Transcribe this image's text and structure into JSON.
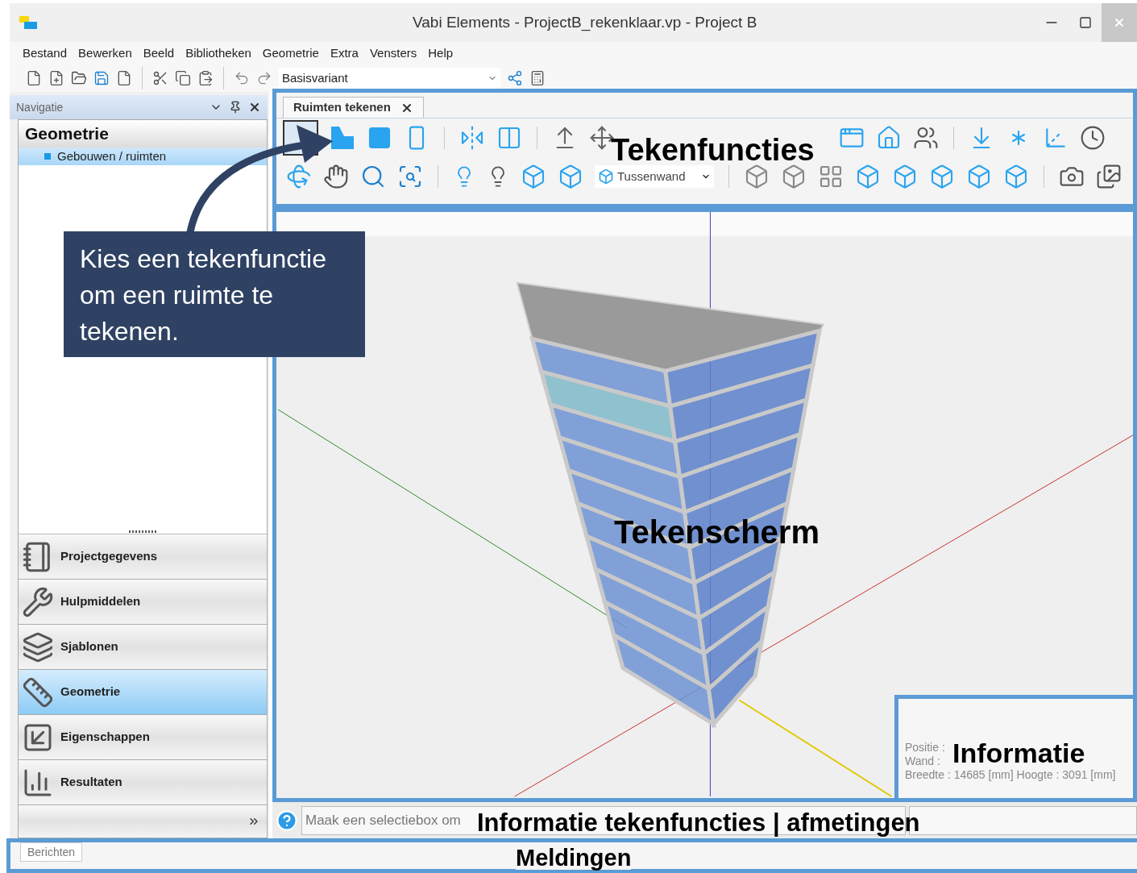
{
  "window": {
    "title": "Vabi Elements - ProjectB_rekenklaar.vp - Project B"
  },
  "menu": [
    "Bestand",
    "Bewerken",
    "Beeld",
    "Bibliotheken",
    "Geometrie",
    "Extra",
    "Vensters",
    "Help"
  ],
  "toolbar": {
    "variant": "Basisvariant"
  },
  "navigation": {
    "title": "Navigatie",
    "heading": "Geometrie",
    "tree": [
      {
        "label": "Gebouwen / ruimten",
        "selected": true
      }
    ],
    "modules": [
      {
        "kind": "project",
        "label": "Projectgegevens",
        "selected": false
      },
      {
        "kind": "tools",
        "label": "Hulpmiddelen",
        "selected": false
      },
      {
        "kind": "templates",
        "label": "Sjablonen",
        "selected": false
      },
      {
        "kind": "geometry",
        "label": "Geometrie",
        "selected": true
      },
      {
        "kind": "properties",
        "label": "Eigenschappen",
        "selected": false
      },
      {
        "kind": "results",
        "label": "Resultaten",
        "selected": false
      }
    ]
  },
  "document_tab": {
    "label": "Ruimten tekenen"
  },
  "drawing_toolbar": {
    "wall_type": "Tussenwand"
  },
  "info_panel": {
    "lines": [
      "Positie :",
      "Wand :",
      "Breedte : 14685 [mm] Hoogte : 3091 [mm]"
    ]
  },
  "status_bar": {
    "hint": "Maak een selectiebox om"
  },
  "messages_tab": {
    "label": "Berichten"
  },
  "annotations": {
    "callout": "Kies een tekenfunctie om een ruimte te tekenen.",
    "toolbar_label": "Tekenfuncties",
    "canvas_label": "Tekenscherm",
    "info_label": "Informatie",
    "status_label": "Informatie tekenfuncties | afmetingen",
    "messages_label": "Meldingen"
  }
}
